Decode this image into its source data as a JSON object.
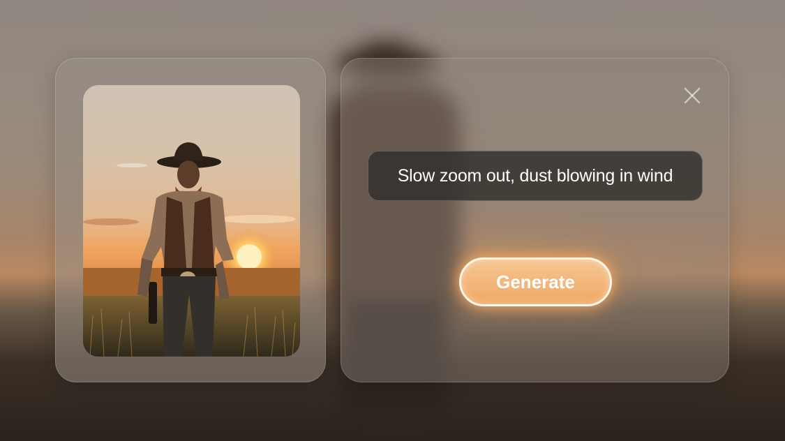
{
  "prompt": {
    "text": "Slow zoom out, dust blowing in wind"
  },
  "actions": {
    "generate_label": "Generate",
    "close_icon": "close-icon"
  },
  "colors": {
    "accent_orange": "#efa967",
    "button_border": "#fff6e8",
    "prompt_bg": "#322e2c"
  }
}
